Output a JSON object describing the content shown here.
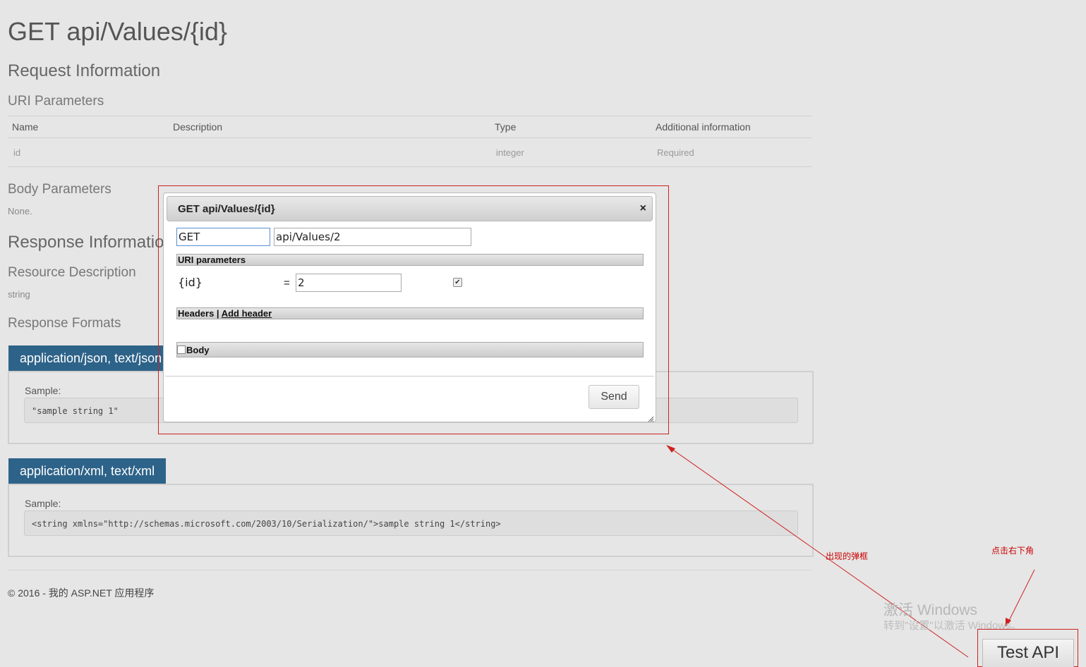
{
  "page": {
    "title": "GET api/Values/{id}",
    "request_info": "Request Information",
    "uri_params_heading": "URI Parameters",
    "table": {
      "headers": [
        "Name",
        "Description",
        "Type",
        "Additional information"
      ],
      "rows": [
        [
          "id",
          "",
          "integer",
          "Required"
        ]
      ]
    },
    "body_params_heading": "Body Parameters",
    "body_params_value": "None.",
    "response_info": "Response Information",
    "resource_desc_heading": "Resource Description",
    "resource_desc_value": "string",
    "response_formats_heading": "Response Formats",
    "formats": [
      {
        "tab": "application/json, text/json",
        "sample_label": "Sample:",
        "sample": "\"sample string 1\""
      },
      {
        "tab": "application/xml, text/xml",
        "sample_label": "Sample:",
        "sample": "<string xmlns=\"http://schemas.microsoft.com/2003/10/Serialization/\">sample string 1</string>"
      }
    ],
    "footer": "© 2016 - 我的 ASP.NET 应用程序"
  },
  "dialog": {
    "title": "GET api/Values/{id}",
    "close": "×",
    "method": "GET",
    "url": "api/Values/2",
    "uri_section": "URI parameters",
    "param_name": "{id}",
    "equals": "=",
    "param_value": "2",
    "param_checked": true,
    "headers_label": "Headers |",
    "add_header": "Add header",
    "body_label": "Body",
    "send": "Send"
  },
  "test_api_button": "Test API",
  "watermark": {
    "line1": "激活 Windows",
    "line2": "转到\"设置\"以激活 Windows。"
  },
  "annotations": {
    "popup_label": "出现的弹框",
    "click_label": "点击右下角"
  },
  "colors": {
    "tab_blue": "#2e6389",
    "annotation_red": "#cc0000",
    "background": "#e6e6e6"
  }
}
